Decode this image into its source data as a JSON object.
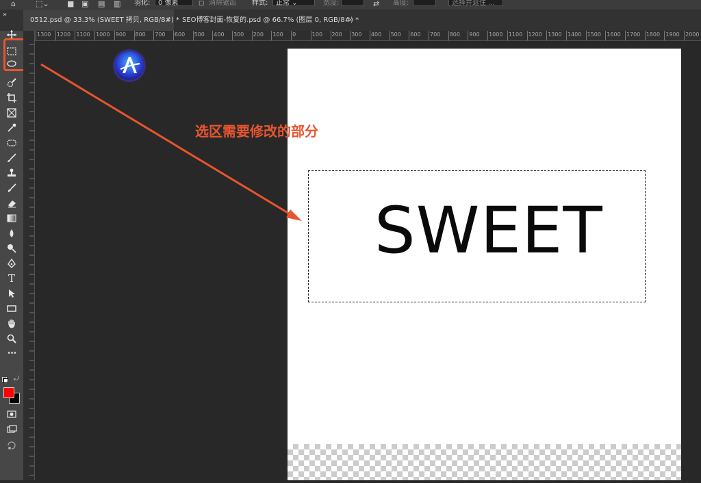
{
  "options_bar": {
    "feather_label": "羽化:",
    "feather_value": "0 像素",
    "antialias_label": "消除锯齿",
    "style_label": "样式:",
    "style_value": "正常",
    "width_label": "宽度:",
    "height_label": "高度:",
    "select_mask_label": "选择并遮住 ..."
  },
  "tabs": [
    {
      "label": "0512.psd @ 33.3% (SWEET 拷贝, RGB/8#) *",
      "close": "×",
      "active": true
    },
    {
      "label": "SEO博客封面-恢复的.psd @ 66.7% (图层 0, RGB/8#) *",
      "close": "×",
      "active": false
    }
  ],
  "toolbar": {
    "collapse": "»",
    "tools": [
      {
        "name": "move-tool",
        "icon": "move-icon"
      },
      {
        "name": "rectangular-marquee-tool",
        "icon": "rectangular-marquee-icon"
      },
      {
        "name": "lasso-tool",
        "icon": "lasso-icon"
      },
      {
        "name": "quick-selection-tool",
        "icon": "quick-selection-icon"
      },
      {
        "name": "crop-tool",
        "icon": "crop-icon"
      },
      {
        "name": "frame-tool",
        "icon": "frame-icon"
      },
      {
        "name": "eyedropper-tool",
        "icon": "eyedropper-icon"
      },
      {
        "name": "healing-brush-tool",
        "icon": "healing-brush-icon"
      },
      {
        "name": "brush-tool",
        "icon": "brush-icon"
      },
      {
        "name": "clone-stamp-tool",
        "icon": "clone-stamp-icon"
      },
      {
        "name": "history-brush-tool",
        "icon": "history-brush-icon"
      },
      {
        "name": "eraser-tool",
        "icon": "eraser-icon"
      },
      {
        "name": "gradient-tool",
        "icon": "gradient-icon"
      },
      {
        "name": "blur-tool",
        "icon": "blur-icon"
      },
      {
        "name": "dodge-tool",
        "icon": "dodge-icon"
      },
      {
        "name": "pen-tool",
        "icon": "pen-icon"
      },
      {
        "name": "type-tool",
        "icon": "type-icon",
        "glyph": "T"
      },
      {
        "name": "path-selection-tool",
        "icon": "path-selection-icon"
      },
      {
        "name": "rectangle-tool",
        "icon": "rectangle-icon"
      },
      {
        "name": "hand-tool",
        "icon": "hand-icon"
      },
      {
        "name": "zoom-tool",
        "icon": "zoom-icon"
      },
      {
        "name": "edit-toolbar",
        "icon": "more-icon",
        "glyph": "•••"
      }
    ],
    "foreground_color": "#ff0000",
    "background_color": "#000000"
  },
  "ruler": {
    "top_labels": [
      "1300",
      "1200",
      "1100",
      "1000",
      "900",
      "800",
      "700",
      "600",
      "500",
      "400",
      "300",
      "200",
      "100",
      "0",
      "100",
      "200",
      "300",
      "400",
      "500",
      "600",
      "700",
      "800",
      "900",
      "1000",
      "1100",
      "1200",
      "1300",
      "1400",
      "1500",
      "1600",
      "1700",
      "1800",
      "1900",
      "2000"
    ]
  },
  "canvas": {
    "text": "SWEET",
    "annotation": "选区需要修改的部分",
    "annotation_color": "#e8552f",
    "highlight_color": "#e8552f"
  }
}
